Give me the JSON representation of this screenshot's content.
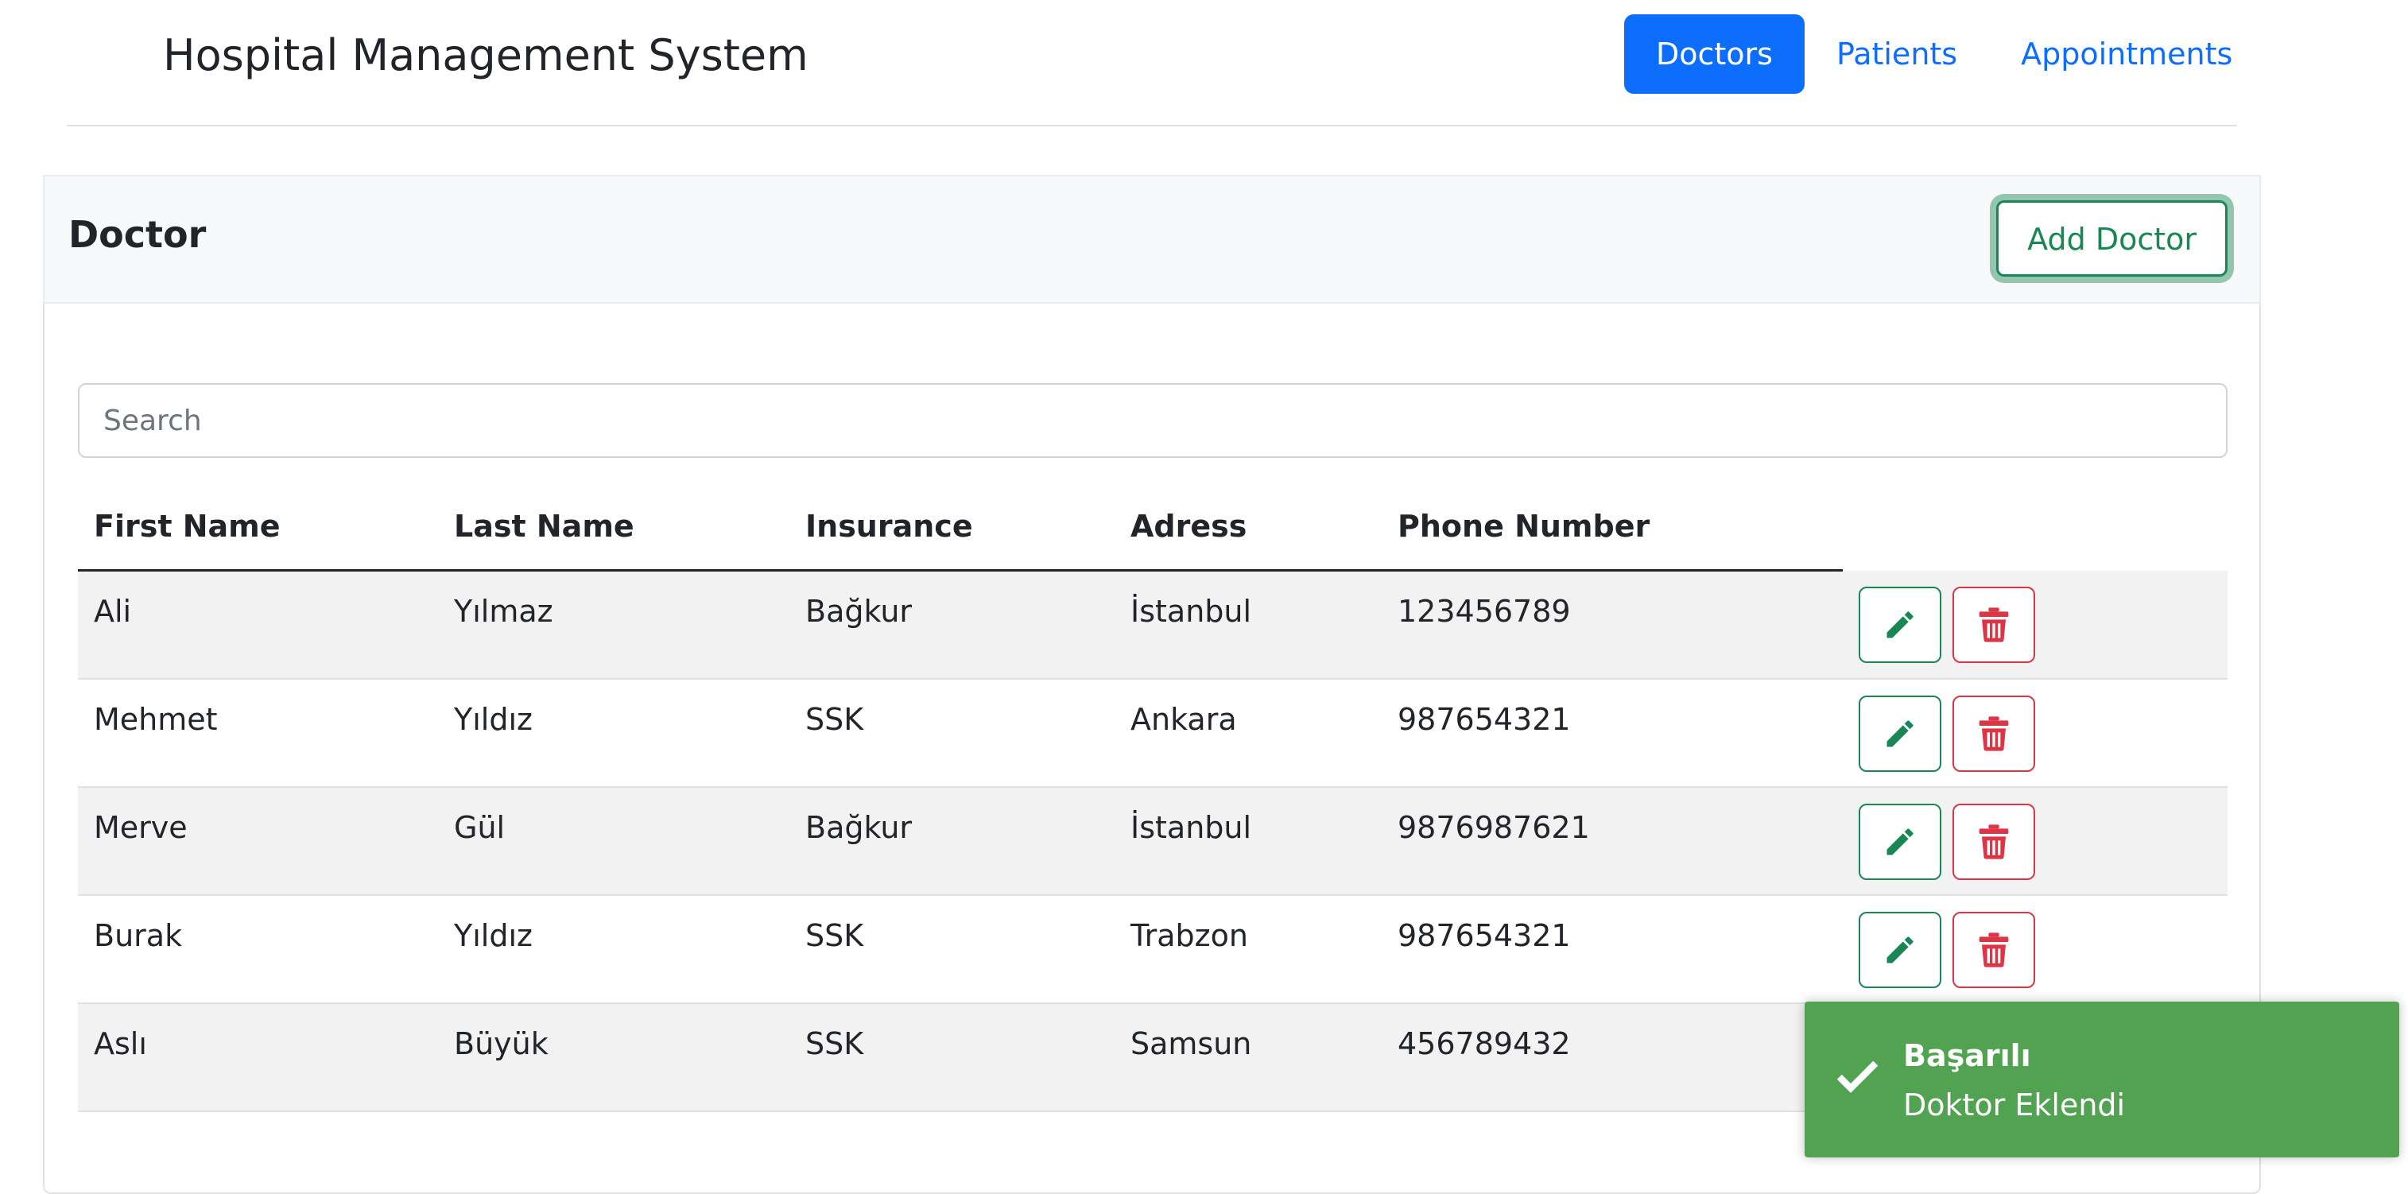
{
  "header": {
    "brand": "Hospital Management System",
    "nav": [
      {
        "label": "Doctors",
        "active": true
      },
      {
        "label": "Patients",
        "active": false
      },
      {
        "label": "Appointments",
        "active": false
      }
    ]
  },
  "card": {
    "title": "Doctor",
    "add_button": "Add Doctor"
  },
  "search": {
    "placeholder": "Search",
    "value": ""
  },
  "table": {
    "columns": [
      "First Name",
      "Last Name",
      "Insurance",
      "Adress",
      "Phone Number",
      ""
    ],
    "rows": [
      {
        "first": "Ali",
        "last": "Yılmaz",
        "insurance": "Bağkur",
        "address": "İstanbul",
        "phone": "123456789"
      },
      {
        "first": "Mehmet",
        "last": "Yıldız",
        "insurance": "SSK",
        "address": "Ankara",
        "phone": "987654321"
      },
      {
        "first": "Merve",
        "last": "Gül",
        "insurance": "Bağkur",
        "address": "İstanbul",
        "phone": "9876987621"
      },
      {
        "first": "Burak",
        "last": "Yıldız",
        "insurance": "SSK",
        "address": "Trabzon",
        "phone": "987654321"
      },
      {
        "first": "Aslı",
        "last": "Büyük",
        "insurance": "SSK",
        "address": "Samsun",
        "phone": "456789432"
      }
    ],
    "row_actions": [
      "pencil-icon",
      "trash-icon"
    ]
  },
  "toast": {
    "title": "Başarılı",
    "message": "Doktor Eklendi",
    "icon": "checkmark-icon"
  },
  "colors": {
    "primary": "#0d6efd",
    "success": "#198754",
    "danger": "#dc3545",
    "toast": "#51a351"
  }
}
